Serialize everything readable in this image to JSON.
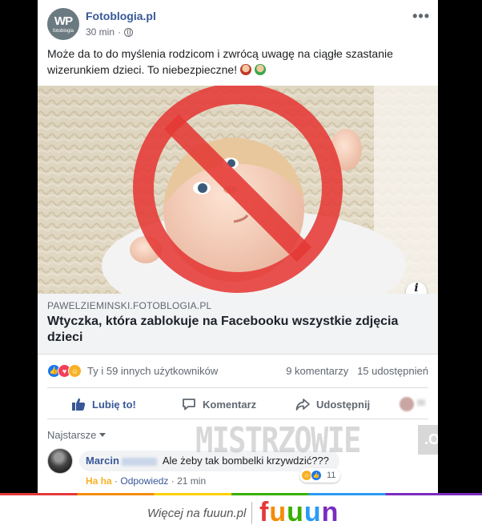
{
  "post": {
    "page_name": "Fotoblogia.pl",
    "avatar_text": "WP",
    "avatar_subtext": "fotoblogia",
    "time": "30 min",
    "separator": "·",
    "more_label": "•••",
    "text": "Może da to do myślenia rodzicom i zwrócą uwagę na ciągłe szastanie wizerunkiem dzieci. To niebezpieczne!"
  },
  "link": {
    "domain": "PAWELZIEMINSKI.FOTOBLOGIA.PL",
    "title": "Wtyczka, która zablokuje na Facebooku wszystkie zdjęcia dzieci",
    "info_label": "i"
  },
  "stats": {
    "reactions_text": "Ty i 59 innych użytkowników",
    "comments_text": "9 komentarzy",
    "shares_text": "15 udostępnień"
  },
  "actions": {
    "like": "Lubię to!",
    "comment": "Komentarz",
    "share": "Udostępnij"
  },
  "comments": {
    "sort_label": "Najstarsze",
    "items": [
      {
        "author_first": "Marcin",
        "text": "Ale żeby tak bombelki krzywdzić???",
        "reaction_label": "Ha ha",
        "reply_label": "Odpowiedz",
        "time": "21 min",
        "reaction_count": "11"
      }
    ]
  },
  "watermark": {
    "text": "MISTRZOWIE",
    "suffix": ".ORG"
  },
  "footer": {
    "text": "Więcej na fuuun.pl",
    "logo_letters": [
      "f",
      "u",
      "u",
      "u",
      "n"
    ]
  },
  "colors": {
    "link_blue": "#385898",
    "prohibition_red": "#e53935",
    "like_blue": "#1877f2",
    "haha_yellow": "#f7b125"
  }
}
